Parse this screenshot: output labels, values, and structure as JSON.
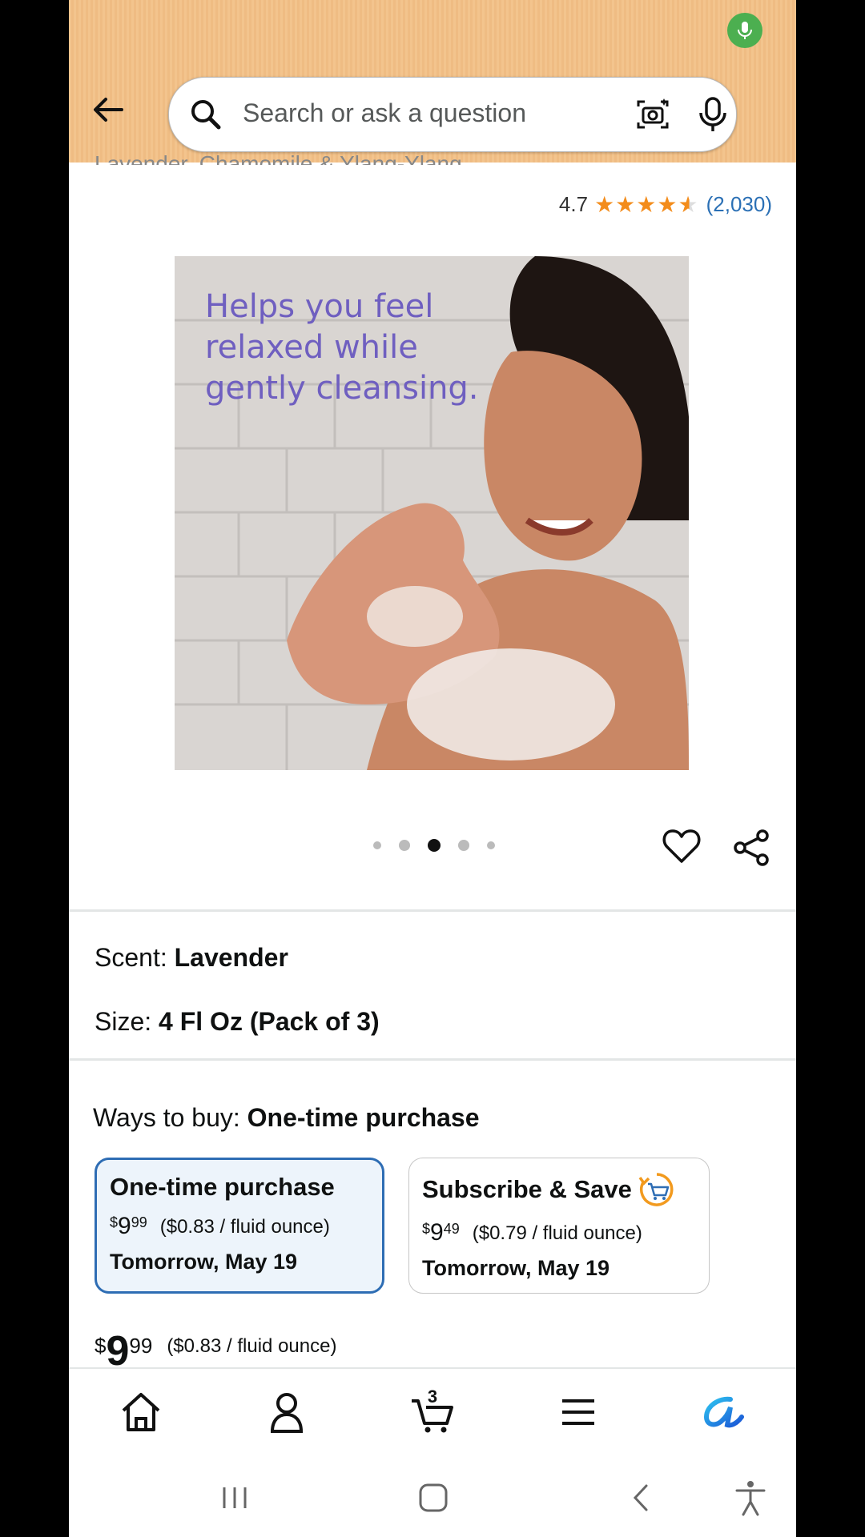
{
  "header": {
    "search_placeholder": "Search or ask a question"
  },
  "product": {
    "partial_subtitle": "Lavender, Chamomile & Ylang-Ylang",
    "rating": "4.7",
    "stars": 4.5,
    "review_count": "(2,030)",
    "image_caption": "Helps you feel\nrelaxed while\ngently cleansing.",
    "carousel": {
      "total": 5,
      "active_index": 2
    }
  },
  "options": {
    "scent_label": "Scent:",
    "scent_value": "Lavender",
    "size_label": "Size:",
    "size_value": "4 Fl Oz (Pack of 3)"
  },
  "buy": {
    "ways_label": "Ways to buy:",
    "ways_value": "One-time purchase",
    "onetime": {
      "title": "One-time purchase",
      "currency": "$",
      "price_whole": "9",
      "price_fraction": "99",
      "unit_price": "($0.83 / fluid ounce)",
      "delivery": "Tomorrow, May 19"
    },
    "subscribe": {
      "title": "Subscribe & Save",
      "currency": "$",
      "price_whole": "9",
      "price_fraction": "49",
      "unit_price": "($0.79 / fluid ounce)",
      "delivery": "Tomorrow, May 19"
    },
    "summary": {
      "currency": "$",
      "price_whole": "9",
      "price_fraction": "99",
      "unit_price": "($0.83 / fluid ounce)"
    }
  },
  "bottom_nav": {
    "cart_count": "3",
    "items": [
      "home-icon",
      "account-icon",
      "cart-icon",
      "menu-icon",
      "rufus-icon"
    ]
  },
  "colors": {
    "header_bg": "#f3c48d",
    "star": "#f38c1b",
    "link": "#2b70b5",
    "selected_border": "#2e6db4",
    "caption": "#6f5fc0"
  }
}
